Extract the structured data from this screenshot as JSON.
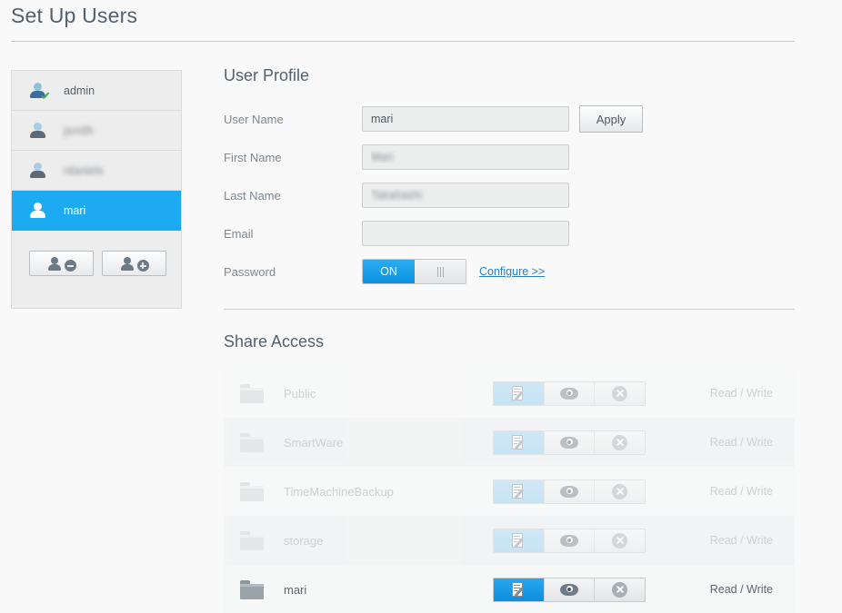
{
  "header": {
    "title": "Set Up Users"
  },
  "sidebar": {
    "users": [
      {
        "name": "admin",
        "blurred": false,
        "selected": false,
        "verified": true
      },
      {
        "name": "jsmith",
        "blurred": true,
        "selected": false,
        "verified": false
      },
      {
        "name": "rdaniels",
        "blurred": true,
        "selected": false,
        "verified": false
      },
      {
        "name": "mari",
        "blurred": false,
        "selected": true,
        "verified": false
      }
    ],
    "remove_user_label": "",
    "add_user_label": ""
  },
  "profile": {
    "title": "User Profile",
    "fields": [
      {
        "label": "User Name",
        "value": "mari",
        "placeholder": "",
        "blurred": false
      },
      {
        "label": "First Name",
        "value": "Mari",
        "placeholder": "",
        "blurred": true
      },
      {
        "label": "Last Name",
        "value": "Takahashi",
        "placeholder": "",
        "blurred": true
      },
      {
        "label": "Email",
        "value": "",
        "placeholder": "",
        "blurred": false
      }
    ],
    "apply_label": "Apply",
    "password": {
      "label": "Password",
      "state": "ON",
      "configure_label": "Configure >>"
    }
  },
  "share_access": {
    "title": "Share Access",
    "permission_icons": [
      "write-icon",
      "eye-icon",
      "deny-icon"
    ],
    "rows": [
      {
        "name": "Public",
        "access": "Read / Write",
        "selected_permission": 0,
        "active": false
      },
      {
        "name": "SmartWare",
        "access": "Read / Write",
        "selected_permission": 0,
        "active": false
      },
      {
        "name": "TimeMachineBackup",
        "access": "Read / Write",
        "selected_permission": 0,
        "active": false
      },
      {
        "name": "storage",
        "access": "Read / Write",
        "selected_permission": 0,
        "active": false
      },
      {
        "name": "mari",
        "access": "Read / Write",
        "selected_permission": 0,
        "active": true
      }
    ]
  },
  "colors": {
    "accent": "#1eaaf1",
    "accent_dark": "#0d8fdd",
    "title": "#53616f",
    "label": "#7d8894",
    "page_bg": "#f9f9f9",
    "row_odd": "#ebedee",
    "row_even": "#f6f7f7",
    "link": "#2a7fc4",
    "check": "#49b24a"
  }
}
